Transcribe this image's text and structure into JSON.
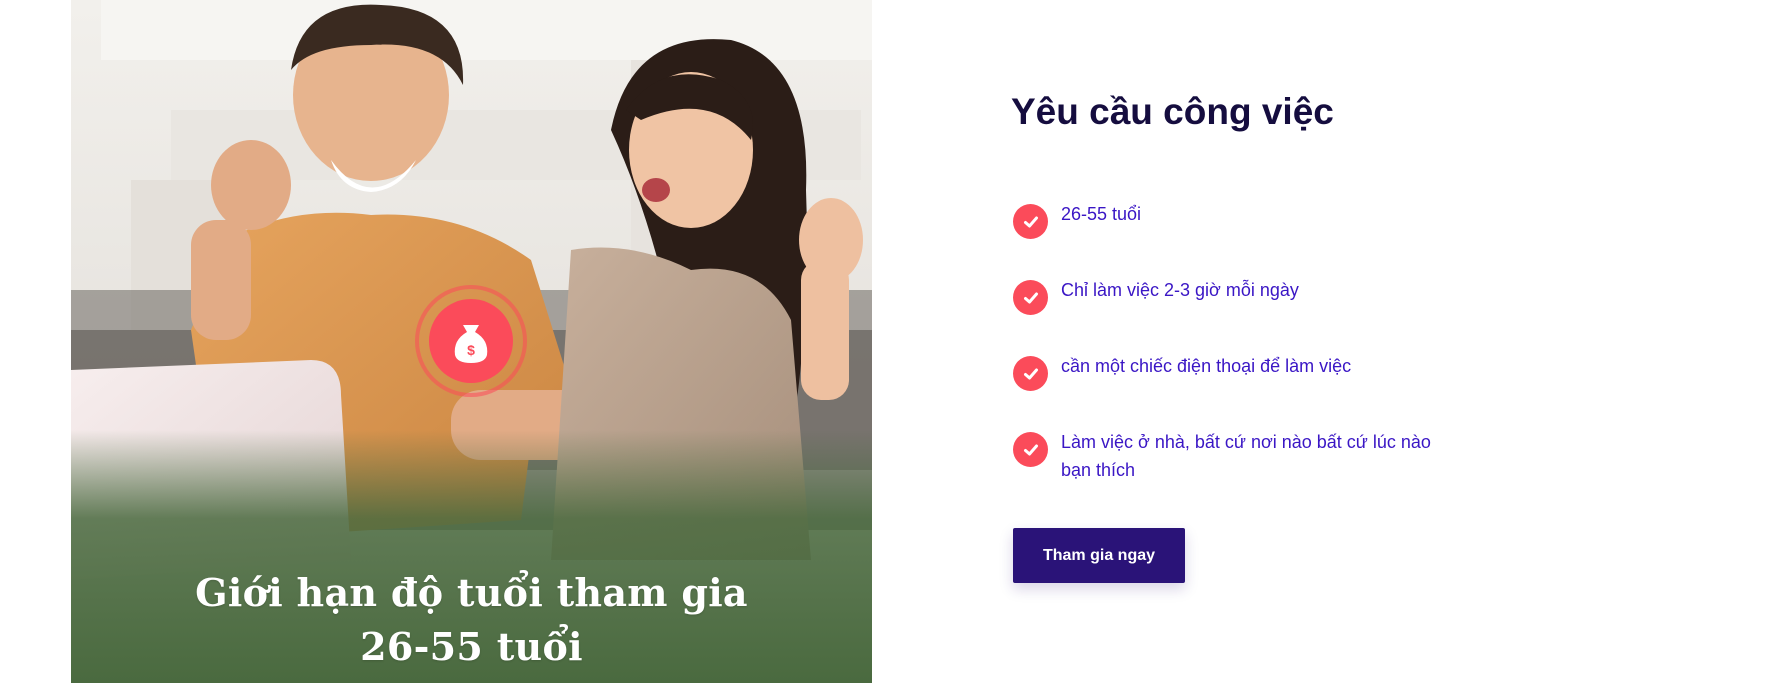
{
  "hero": {
    "caption_line1": "Giới hạn độ tuổi tham gia",
    "caption_line2": "26-55 tuổi",
    "badge_icon": "money-bag-icon",
    "badge_glyph": "$"
  },
  "requirements": {
    "title": "Yêu cầu công việc",
    "items": [
      {
        "icon": "check-icon",
        "line1": "26-55 tuổi",
        "line2": ""
      },
      {
        "icon": "check-icon",
        "line1": "Chỉ làm việc 2-3 giờ mỗi ngày",
        "line2": ""
      },
      {
        "icon": "check-icon",
        "line1": "cần một chiếc điện thoại để làm việc",
        "line2": ""
      },
      {
        "icon": "check-icon",
        "line1": "Làm việc ở nhà, bất cứ nơi nào bất cứ lúc nào",
        "line2": "bạn thích"
      }
    ]
  },
  "cta": {
    "label": "Tham gia ngay"
  },
  "colors": {
    "accent_red": "#fb4b5a",
    "title_navy": "#150d3f",
    "text_violet": "#3a16c5",
    "button_purple": "#2a1378",
    "caption_band_green": "#4a6a3f"
  }
}
